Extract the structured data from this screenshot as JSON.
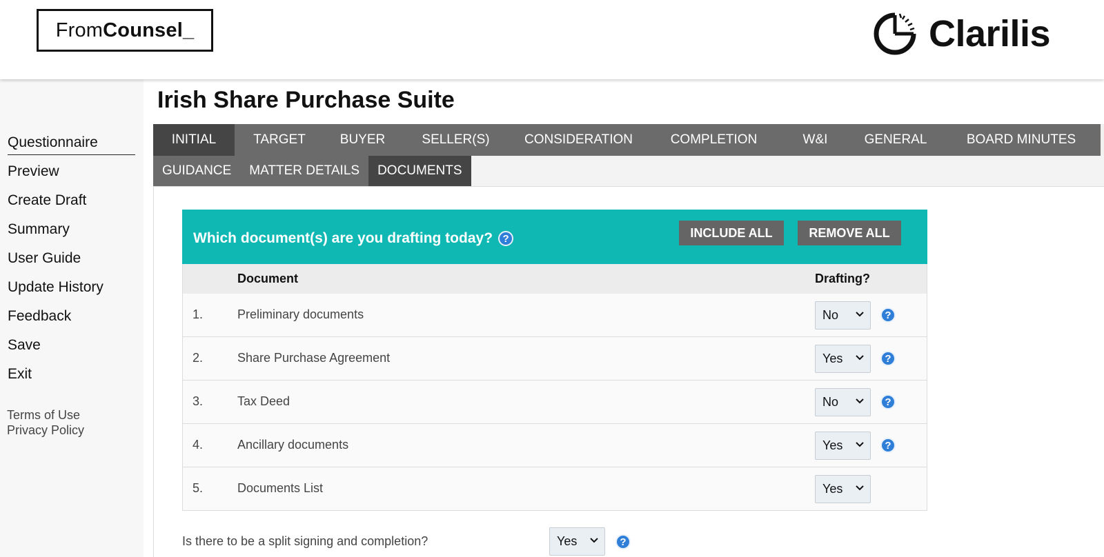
{
  "header": {
    "brand_left_thin": "From",
    "brand_left_bold": "Counsel_",
    "brand_right": "Clarilis"
  },
  "sidebar": {
    "items": [
      {
        "label": "Questionnaire"
      },
      {
        "label": "Preview"
      },
      {
        "label": "Create Draft"
      },
      {
        "label": "Summary"
      },
      {
        "label": "User Guide"
      },
      {
        "label": "Update History"
      },
      {
        "label": "Feedback"
      },
      {
        "label": "Save"
      },
      {
        "label": "Exit"
      }
    ],
    "legal": [
      "Terms of Use",
      "Privacy Policy"
    ]
  },
  "page_title": "Irish Share Purchase Suite",
  "tabs": [
    "INITIAL",
    "TARGET",
    "BUYER",
    "SELLER(S)",
    "CONSIDERATION",
    "COMPLETION",
    "W&I",
    "GENERAL",
    "BOARD MINUTES"
  ],
  "subtabs": [
    "GUIDANCE",
    "MATTER DETAILS",
    "DOCUMENTS"
  ],
  "panel": {
    "title": "Which document(s) are you drafting today?",
    "include_all": "INCLUDE ALL",
    "remove_all": "REMOVE ALL",
    "col_document": "Document",
    "col_drafting": "Drafting?",
    "rows": [
      {
        "num": "1.",
        "doc": "Preliminary documents",
        "value": "No"
      },
      {
        "num": "2.",
        "doc": "Share Purchase Agreement",
        "value": "Yes"
      },
      {
        "num": "3.",
        "doc": "Tax Deed",
        "value": "No"
      },
      {
        "num": "4.",
        "doc": "Ancillary documents",
        "value": "Yes"
      },
      {
        "num": "5.",
        "doc": "Documents List",
        "value": "Yes"
      }
    ]
  },
  "split": {
    "question": "Is there to be a split signing and completion?",
    "value": "Yes"
  },
  "help_glyph": "?",
  "colors": {
    "teal": "#0fb8b3",
    "tab_gray": "#6b6b6b",
    "tab_active": "#454545",
    "help_blue": "#2f7ed8"
  },
  "icons": [
    "clarilis-logo-icon",
    "help-icon",
    "chevron-down-icon"
  ]
}
